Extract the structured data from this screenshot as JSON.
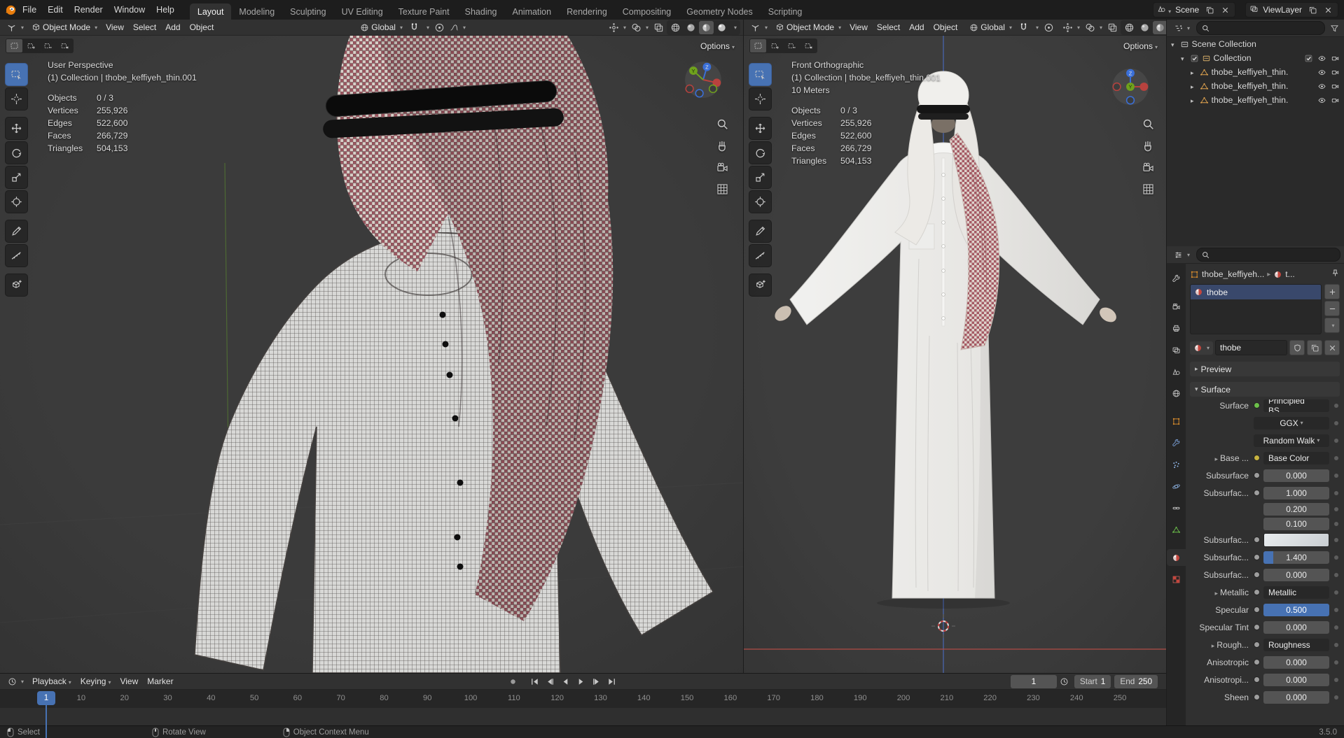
{
  "colors": {
    "accent_blue": "#4772b3",
    "axis_x_red": "#b8423e",
    "axis_y_green": "#6fa21c",
    "axis_z_blue": "#3a6fd8",
    "keffiyeh_red": "#9b5660",
    "material_sphere_red": "#c4463d"
  },
  "topbar": {
    "app_menus": [
      "File",
      "Edit",
      "Render",
      "Window",
      "Help"
    ],
    "workspaces": [
      "Layout",
      "Modeling",
      "Sculpting",
      "UV Editing",
      "Texture Paint",
      "Shading",
      "Animation",
      "Rendering",
      "Compositing",
      "Geometry Nodes",
      "Scripting"
    ],
    "active_workspace": "Layout",
    "scene_name": "Scene",
    "view_layer_name": "ViewLayer"
  },
  "viewport_left": {
    "header": {
      "mode": "Object Mode",
      "menus": [
        "View",
        "Select",
        "Add",
        "Object"
      ],
      "orientation": "Global"
    },
    "options_label": "Options",
    "view_label": "User Perspective",
    "context_label": "(1) Collection | thobe_keffiyeh_thin.001",
    "stats": [
      {
        "label": "Objects",
        "value": "0 / 3"
      },
      {
        "label": "Vertices",
        "value": "255,926"
      },
      {
        "label": "Edges",
        "value": "522,600"
      },
      {
        "label": "Faces",
        "value": "266,729"
      },
      {
        "label": "Triangles",
        "value": "504,153"
      }
    ]
  },
  "viewport_right": {
    "header": {
      "mode": "Object Mode",
      "menus": [
        "View",
        "Select",
        "Add",
        "Object"
      ],
      "orientation": "Global"
    },
    "options_label": "Options",
    "view_label": "Front Orthographic",
    "context_label": "(1) Collection | thobe_keffiyeh_thin.001",
    "scale_label": "10 Meters",
    "stats": [
      {
        "label": "Objects",
        "value": "0 / 3"
      },
      {
        "label": "Vertices",
        "value": "255,926"
      },
      {
        "label": "Edges",
        "value": "522,600"
      },
      {
        "label": "Faces",
        "value": "266,729"
      },
      {
        "label": "Triangles",
        "value": "504,153"
      }
    ]
  },
  "outliner": {
    "scene_collection_label": "Scene Collection",
    "collection_label": "Collection",
    "objects": [
      {
        "name": "thobe_keffiyeh_thin."
      },
      {
        "name": "thobe_keffiyeh_thin."
      },
      {
        "name": "thobe_keffiyeh_thin."
      }
    ]
  },
  "properties": {
    "breadcrumb_object": "thobe_keffiyeh...",
    "breadcrumb_material": "t...",
    "slot_name": "thobe",
    "material_name": "thobe",
    "preview_panel_label": "Preview",
    "surface_panel_label": "Surface",
    "surface_label": "Surface",
    "surface_value": "Principled BS...",
    "distribution_value": "GGX",
    "subsurface_method_value": "Random Walk",
    "rows": [
      {
        "label": "Base ...",
        "value": "Base Color"
      },
      {
        "label": "Subsurface",
        "value": "0.000"
      },
      {
        "label": "Subsurfac...",
        "value": "1.000"
      },
      {
        "label": "",
        "value": "0.200"
      },
      {
        "label": "",
        "value": "0.100"
      },
      {
        "label": "Subsurfac...",
        "value": ""
      },
      {
        "label": "Subsurfac...",
        "value": "1.400"
      },
      {
        "label": "Subsurfac...",
        "value": "0.000"
      },
      {
        "label": "Metallic",
        "value": "Metallic"
      },
      {
        "label": "Specular",
        "value": "0.500"
      },
      {
        "label": "Specular Tint",
        "value": "0.000"
      },
      {
        "label": "Rough...",
        "value": "Roughness"
      },
      {
        "label": "Anisotropic",
        "value": "0.000"
      },
      {
        "label": "Anisotropi...",
        "value": "0.000"
      },
      {
        "label": "Sheen",
        "value": "0.000"
      }
    ]
  },
  "timeline": {
    "menus": [
      "Playback",
      "Keying",
      "View",
      "Marker"
    ],
    "current_frame": "1",
    "start_label": "Start",
    "start_value": "1",
    "end_label": "End",
    "end_value": "250",
    "ticks": [
      "10",
      "20",
      "30",
      "40",
      "50",
      "60",
      "70",
      "80",
      "90",
      "100",
      "110",
      "120",
      "130",
      "140",
      "150",
      "160",
      "170",
      "180",
      "190",
      "200",
      "210",
      "220",
      "230",
      "240",
      "250"
    ]
  },
  "statusbar": {
    "select": "Select",
    "rotate_view": "Rotate View",
    "context_menu": "Object Context Menu",
    "version": "3.5.0"
  }
}
